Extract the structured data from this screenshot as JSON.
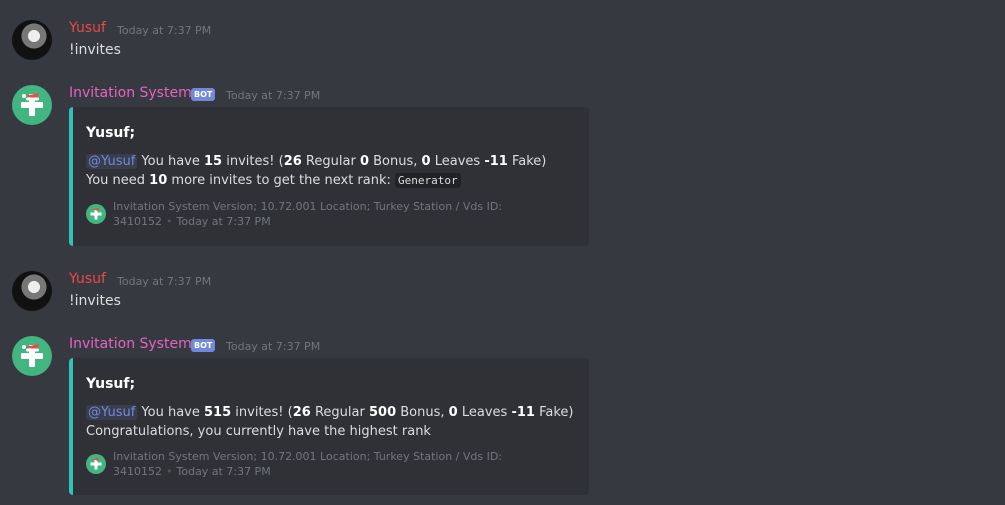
{
  "messages": [
    {
      "author": "Yusuf",
      "timestamp": "Today at 7:37 PM",
      "text": "!invites"
    },
    {
      "author": "Invitation System",
      "bot_tag": "BOT",
      "timestamp": "Today at 7:37 PM",
      "embed": {
        "title": "Yusuf;",
        "mention": "@Yusuf",
        "line1": {
          "prefix": "You have",
          "invites": "15",
          "suffix": "invites! (",
          "regular": "26",
          "regular_label": "Regular",
          "bonus": "0",
          "bonus_label": "Bonus,",
          "leaves": "0",
          "leaves_label": "Leaves",
          "fake": "-11",
          "fake_label": "Fake)"
        },
        "line2_prefix": "You need",
        "line2_count": "10",
        "line2_suffix": "more invites to get the next rank:",
        "rank_code": "Generator",
        "footer": "Invitation System Version; 10.72.001 Location; Turkey Station / Vds ID: 3410152",
        "footer_time": "Today at 7:37 PM"
      }
    },
    {
      "author": "Yusuf",
      "timestamp": "Today at 7:37 PM",
      "text": "!invites"
    },
    {
      "author": "Invitation System",
      "bot_tag": "BOT",
      "timestamp": "Today at 7:37 PM",
      "embed": {
        "title": "Yusuf;",
        "mention": "@Yusuf",
        "line1": {
          "prefix": "You have",
          "invites": "515",
          "suffix": "invites! (",
          "regular": "26",
          "regular_label": "Regular",
          "bonus": "500",
          "bonus_label": "Bonus,",
          "leaves": "0",
          "leaves_label": "Leaves",
          "fake": "-11",
          "fake_label": "Fake)"
        },
        "line2": "Congratulations, you currently have the highest rank",
        "footer": "Invitation System Version; 10.72.001 Location; Turkey Station / Vds ID: 3410152",
        "footer_time": "Today at 7:37 PM"
      }
    }
  ],
  "colors": {
    "background": "#36393f",
    "embed_bg": "#2f3136",
    "embed_accent": "#2ec4b6",
    "user_name": "#f04747",
    "bot_name": "#e663c6",
    "bot_tag": "#7289da"
  },
  "icons": {
    "bot_avatar": "green-plus-santa-hat-icon",
    "user_avatar": "user-avatar"
  }
}
